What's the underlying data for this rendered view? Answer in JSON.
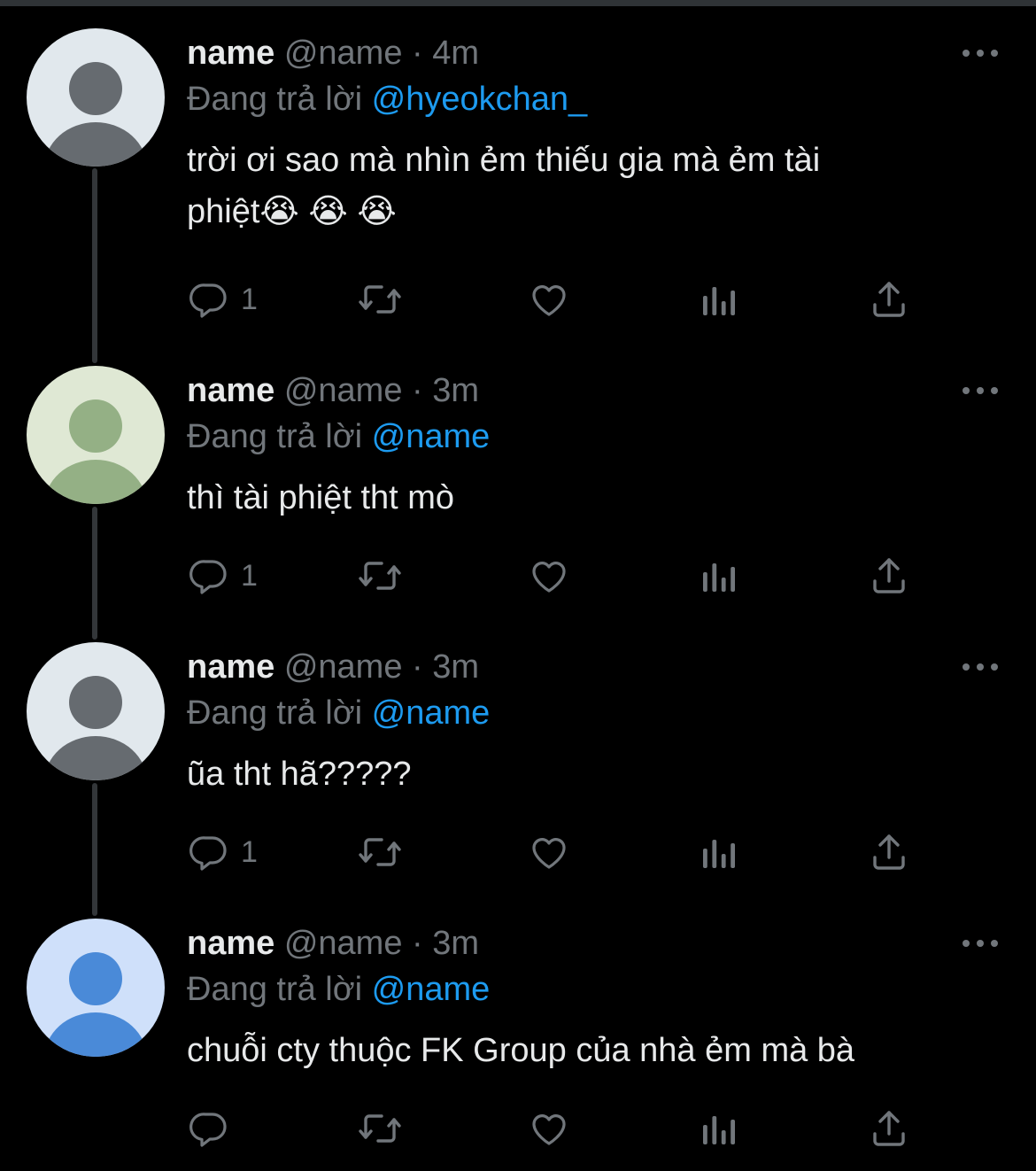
{
  "label_replying": "Đang trả lời",
  "label_dot": "·",
  "colors": {
    "background": "#000000",
    "text": "#e7e9ea",
    "muted": "#71767b",
    "link": "#1d9bf0",
    "thread_line": "#333639"
  },
  "icons": [
    "reply-icon",
    "retweet-icon",
    "like-icon",
    "views-icon",
    "share-icon",
    "more-icon",
    "default-avatar-icon"
  ],
  "tweets": [
    {
      "display_name": "name",
      "handle": "@name",
      "time": "4m",
      "reply_to": "@hyeokchan_",
      "text_line1": "trời ơi sao mà nhìn ẻm thiếu gia mà ẻm tài",
      "text_line2": "phiệt😭 😭 😭",
      "reply_count": "1",
      "avatar_bg": "#e1e8ed",
      "avatar_fg": "#666b70"
    },
    {
      "display_name": "name",
      "handle": "@name",
      "time": "3m",
      "reply_to": "@name",
      "text_line1": "thì tài phiệt tht mò",
      "reply_count": "1",
      "avatar_bg": "#dfe8d4",
      "avatar_fg": "#94b085"
    },
    {
      "display_name": "name",
      "handle": "@name",
      "time": "3m",
      "reply_to": "@name",
      "text_line1": "ũa tht hã?????",
      "reply_count": "1",
      "avatar_bg": "#e1e8ed",
      "avatar_fg": "#666b70"
    },
    {
      "display_name": "name",
      "handle": "@name",
      "time": "3m",
      "reply_to": "@name",
      "text_line1": "chuỗi cty thuộc FK Group của nhà ẻm mà bà",
      "reply_count": "",
      "avatar_bg": "#cfe0fa",
      "avatar_fg": "#4a8ad8"
    }
  ]
}
